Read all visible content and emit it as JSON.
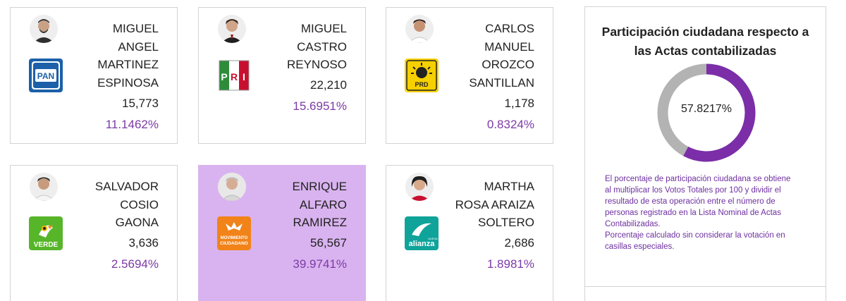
{
  "candidates": [
    {
      "name_lines": [
        "MIGUEL",
        "ANGEL",
        "MARTINEZ",
        "ESPINOSA"
      ],
      "votes": "15,773",
      "percentage": "11.1462%",
      "party": "PAN",
      "party_label": "PAN",
      "party_color": "#1b60a8",
      "highlighted": false
    },
    {
      "name_lines": [
        "MIGUEL",
        "CASTRO",
        "REYNOSO"
      ],
      "votes": "22,210",
      "percentage": "15.6951%",
      "party": "PRI",
      "party_label": "PRI",
      "party_color": "#c8102e",
      "highlighted": false
    },
    {
      "name_lines": [
        "CARLOS",
        "MANUEL",
        "OROZCO",
        "SANTILLAN"
      ],
      "votes": "1,178",
      "percentage": "0.8324%",
      "party": "PRD",
      "party_label": "PRD",
      "party_color": "#f7d000",
      "highlighted": false
    },
    {
      "name_lines": [
        "SALVADOR",
        "COSIO",
        "GAONA"
      ],
      "votes": "3,636",
      "percentage": "2.5694%",
      "party": "VERDE",
      "party_label": "VERDE",
      "party_color": "#57b52a",
      "highlighted": false
    },
    {
      "name_lines": [
        "ENRIQUE",
        "ALFARO",
        "RAMIREZ"
      ],
      "votes": "56,567",
      "percentage": "39.9741%",
      "party": "MOVIMIENTO CIUDADANO",
      "party_label": "MOVIMIENTO CIUDADANO",
      "party_color": "#f18319",
      "highlighted": true
    },
    {
      "name_lines": [
        "MARTHA",
        "ROSA ARAIZA",
        "SOLTERO"
      ],
      "votes": "2,686",
      "percentage": "1.8981%",
      "party": "NUEVA ALIANZA",
      "party_label": "alianza",
      "party_sub": "NUEVA",
      "party_color": "#0fa39a",
      "highlighted": false
    }
  ],
  "participation": {
    "title": "Participación ciudadana respecto a las Actas contabilizadas",
    "percentage_label": "57.8217%",
    "percentage_value": 57.8217,
    "fill_color": "#7b2ea8",
    "track_color": "#b3b3b3",
    "note_lines": [
      "El porcentaje de participación ciudadana se obtiene",
      "al multiplicar los Votos Totales por 100 y dividir el",
      "resultado de esta operación entre el número de",
      "personas registrado en la Lista Nominal de Actas",
      "Contabilizadas.",
      "Porcentaje calculado sin considerar la votación en",
      "casillas especiales."
    ]
  }
}
